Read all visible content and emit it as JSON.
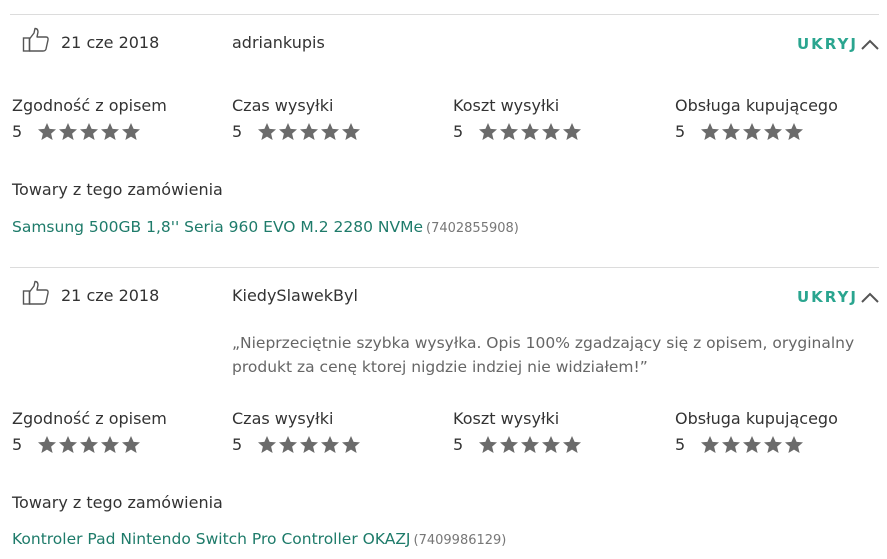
{
  "reviews": [
    {
      "date": "21 cze 2018",
      "user": "adriankupis",
      "hide_label": "UKRYJ",
      "comment": "",
      "ratings": [
        {
          "label": "Zgodność z opisem",
          "value": "5",
          "stars": 5
        },
        {
          "label": "Czas wysyłki",
          "value": "5",
          "stars": 5
        },
        {
          "label": "Koszt wysyłki",
          "value": "5",
          "stars": 5
        },
        {
          "label": "Obsługa kupującego",
          "value": "5",
          "stars": 5
        }
      ],
      "items_title": "Towary z tego zamówienia",
      "product_name": "Samsung 500GB 1,8'' Seria 960 EVO M.2 2280 NVMe",
      "product_id": "(7402855908)"
    },
    {
      "date": "21 cze 2018",
      "user": "KiedySlawekByl",
      "hide_label": "UKRYJ",
      "comment": "„Nieprzeciętnie szybka wysyłka. Opis 100% zgadzający się z opisem, oryginalny produkt za cenę ktorej nigdzie indziej nie widziałem!”",
      "ratings": [
        {
          "label": "Zgodność z opisem",
          "value": "5",
          "stars": 5
        },
        {
          "label": "Czas wysyłki",
          "value": "5",
          "stars": 5
        },
        {
          "label": "Koszt wysyłki",
          "value": "5",
          "stars": 5
        },
        {
          "label": "Obsługa kupującego",
          "value": "5",
          "stars": 5
        }
      ],
      "items_title": "Towary z tego zamówienia",
      "product_name": "Kontroler Pad Nintendo Switch Pro Controller OKAZJ",
      "product_id": "(7409986129)"
    }
  ],
  "colors": {
    "accent": "#2aa58f",
    "link": "#1e7b6a",
    "star": "#6b6b6b"
  },
  "icons": {
    "like": "thumbs-up-icon",
    "collapse": "chevron-up-icon",
    "star": "star-icon"
  }
}
